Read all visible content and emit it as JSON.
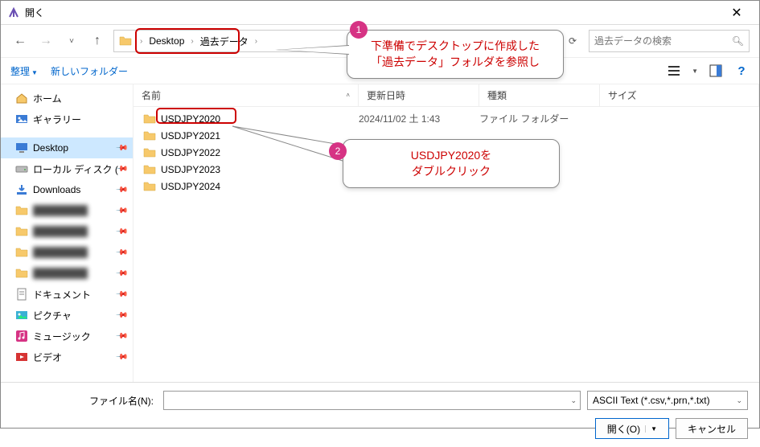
{
  "titlebar": {
    "title": "開く"
  },
  "nav": {
    "breadcrumb": [
      "Desktop",
      "過去データ"
    ],
    "search_placeholder": "過去データの検索"
  },
  "toolbar": {
    "organize": "整理",
    "new_folder": "新しいフォルダー"
  },
  "sidebar": {
    "items": [
      {
        "label": "ホーム",
        "icon": "home",
        "pinned": false
      },
      {
        "label": "ギャラリー",
        "icon": "gallery",
        "pinned": false
      },
      {
        "label": "Desktop",
        "icon": "desktop",
        "pinned": true,
        "selected": true
      },
      {
        "label": "ローカル ディスク (",
        "icon": "disk",
        "pinned": true
      },
      {
        "label": "Downloads",
        "icon": "downloads",
        "pinned": true
      },
      {
        "label": "",
        "icon": "folder",
        "pinned": true,
        "blurred": true
      },
      {
        "label": "",
        "icon": "folder",
        "pinned": true,
        "blurred": true
      },
      {
        "label": "",
        "icon": "folder",
        "pinned": true,
        "blurred": true
      },
      {
        "label": "",
        "icon": "folder",
        "pinned": true,
        "blurred": true
      },
      {
        "label": "ドキュメント",
        "icon": "document",
        "pinned": true
      },
      {
        "label": "ピクチャ",
        "icon": "pictures",
        "pinned": true
      },
      {
        "label": "ミュージック",
        "icon": "music",
        "pinned": true
      },
      {
        "label": "ビデオ",
        "icon": "video",
        "pinned": true
      }
    ]
  },
  "columns": {
    "name": "名前",
    "date": "更新日時",
    "type": "種類",
    "size": "サイズ"
  },
  "files": [
    {
      "name": "USDJPY2020",
      "date": "2024/11/02 土 1:43",
      "type": "ファイル フォルダー"
    },
    {
      "name": "USDJPY2021",
      "date": "",
      "type": ""
    },
    {
      "name": "USDJPY2022",
      "date": "",
      "type": ""
    },
    {
      "name": "USDJPY2023",
      "date": "",
      "type": ""
    },
    {
      "name": "USDJPY2024",
      "date": "",
      "type": ""
    }
  ],
  "bottom": {
    "filename_label": "ファイル名(N):",
    "filter": "ASCII Text (*.csv,*.prn,*.txt)",
    "open": "開く(O)",
    "cancel": "キャンセル"
  },
  "annotations": {
    "badge1": "1",
    "callout1_l1": "下準備でデスクトップに作成した",
    "callout1_l2": "「過去データ」フォルダを参照し",
    "badge2": "2",
    "callout2_l1": "USDJPY2020を",
    "callout2_l2": "ダブルクリック"
  }
}
